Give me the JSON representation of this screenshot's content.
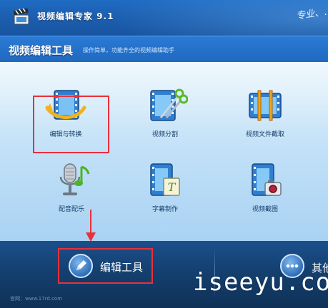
{
  "app": {
    "title": "视频编辑专家 9.1",
    "slogan": "专业、…"
  },
  "header": {
    "title": "视频编辑工具",
    "subtitle": "操作简单，功能齐全的视频编辑助手"
  },
  "tools": [
    {
      "label": "编辑与转换",
      "icon": "film-convert-icon"
    },
    {
      "label": "视频分割",
      "icon": "film-scissors-icon"
    },
    {
      "label": "视频文件截取",
      "icon": "film-trim-icon"
    },
    {
      "label": "配音配乐",
      "icon": "microphone-music-icon"
    },
    {
      "label": "字幕制作",
      "icon": "film-subtitle-icon"
    },
    {
      "label": "视频截图",
      "icon": "film-camera-icon"
    }
  ],
  "bottom_nav": {
    "edit_tools_label": "编辑工具",
    "other_label": "其他"
  },
  "watermark": {
    "site": "官网：www.17rd.com",
    "brand": "iseeyu.com"
  },
  "colors": {
    "title_bar": "#1c5fb0",
    "panel_light": "#dff0fb",
    "bottom_bar": "#14406f",
    "annotation_red": "#e8313a",
    "label_text": "#163e6a"
  }
}
